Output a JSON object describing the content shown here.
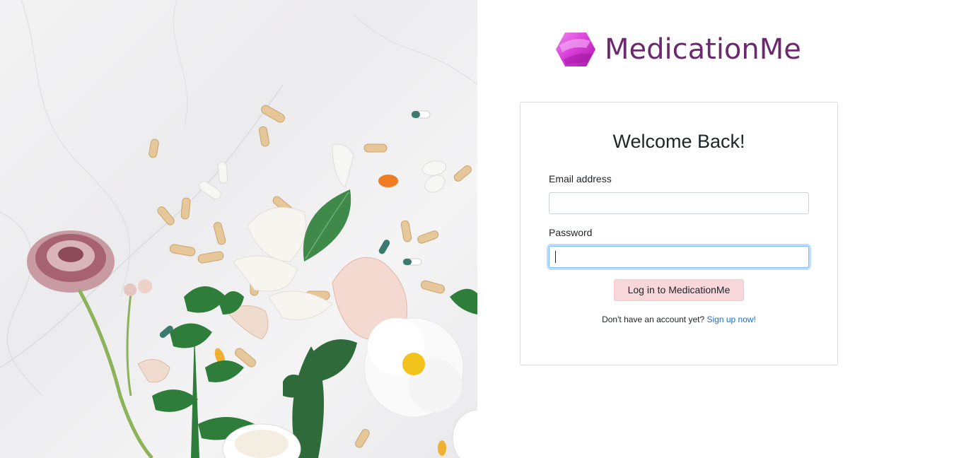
{
  "brand": {
    "name": "MedicationMe",
    "logo_icon": "hexagon-gem-icon",
    "color": "#6b2a6e",
    "logo_color": "#d63bd6"
  },
  "login_card": {
    "title": "Welcome Back!",
    "email_label": "Email address",
    "email_value": "",
    "password_label": "Password",
    "password_value": "",
    "submit_label": "Log in to MedicationMe",
    "signup_prompt": "Don't have an account yet?",
    "signup_link": "Sign up now!"
  },
  "photo": {
    "subject": "pills-and-flowers-photo"
  },
  "colors": {
    "button_bg": "#f8d7da",
    "link": "#1a6fc9",
    "focus": "#80bdff"
  }
}
